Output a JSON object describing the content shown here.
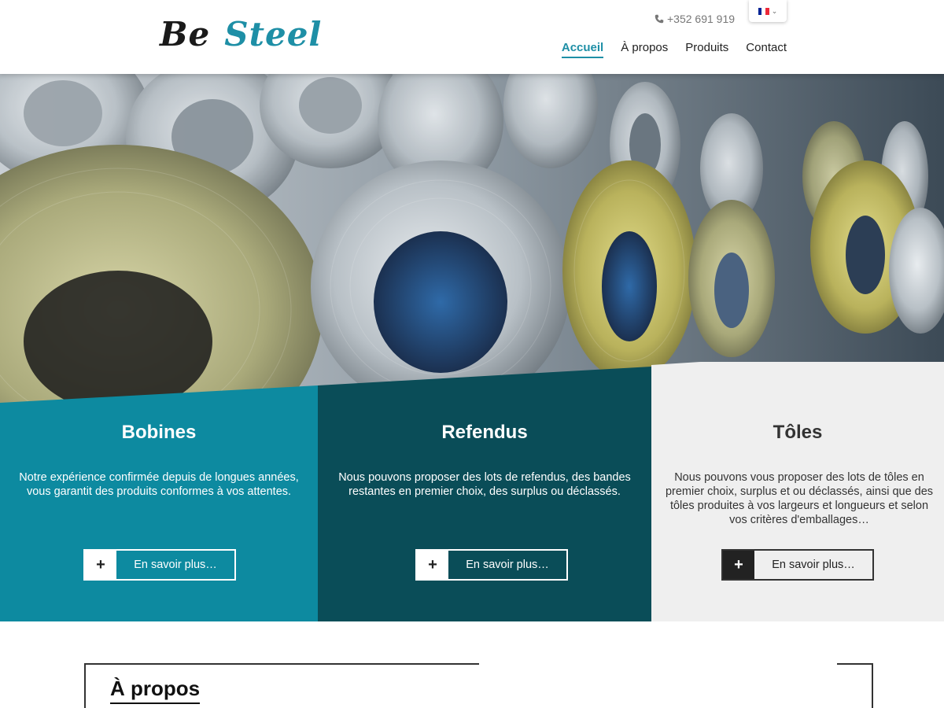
{
  "header": {
    "logo": {
      "word1": "Be",
      "word2": "Steel"
    },
    "phone": "+352 691 919",
    "language": {
      "flag_colors": [
        "#002395",
        "#ffffff",
        "#ed2939"
      ]
    },
    "nav": [
      {
        "label": "Accueil",
        "active": true
      },
      {
        "label": "À propos",
        "active": false
      },
      {
        "label": "Produits",
        "active": false
      },
      {
        "label": "Contact",
        "active": false
      }
    ]
  },
  "panels": [
    {
      "title": "Bobines",
      "text": "Notre expérience confirmée depuis de longues années, vous garantit des produits conformes à vos attentes.",
      "button": "En savoir plus…",
      "plus": "+"
    },
    {
      "title": "Refendus",
      "text": "Nous pouvons proposer des lots de refendus, des bandes restantes en premier choix, des surplus ou déclassés.",
      "button": "En savoir plus…",
      "plus": "+"
    },
    {
      "title": "Tôles",
      "text": "Nous pouvons vous proposer des lots de tôles en premier choix, surplus et ou déclassés, ainsi que des tôles produites à vos largeurs et longueurs et selon vos critères d'emballages…",
      "button": "En savoir plus…",
      "plus": "+"
    }
  ],
  "about": {
    "title": "À propos"
  },
  "colors": {
    "accent": "#1e8fa6",
    "panel1": "#0d8aa0",
    "panel2": "#0a4d58",
    "panel3": "#efefef"
  }
}
